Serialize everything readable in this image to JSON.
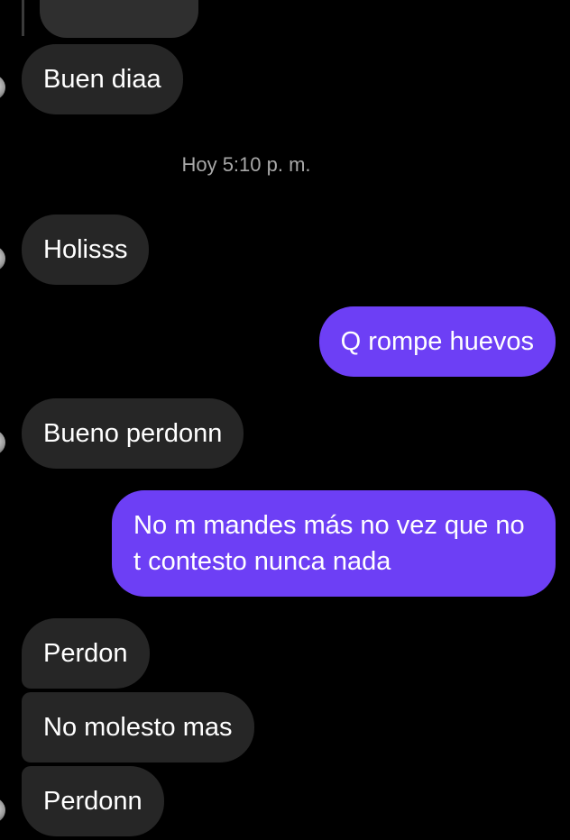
{
  "messages": [
    {
      "id": "m1",
      "direction": "in",
      "text": "Buen diaa"
    },
    {
      "id": "m2",
      "direction": "in",
      "text": "Holisss"
    },
    {
      "id": "m3",
      "direction": "out",
      "text": "Q rompe huevos"
    },
    {
      "id": "m4",
      "direction": "in",
      "text": "Bueno perdonn"
    },
    {
      "id": "m5",
      "direction": "out",
      "text": "No m mandes más no vez que no t contesto nunca nada"
    },
    {
      "id": "m6",
      "direction": "in",
      "text": "Perdon"
    },
    {
      "id": "m7",
      "direction": "in",
      "text": "No molesto mas"
    },
    {
      "id": "m8",
      "direction": "in",
      "text": "Perdonn"
    }
  ],
  "timestamp": "Hoy 5:10 p. m.",
  "colors": {
    "incoming_bubble": "#262626",
    "outgoing_bubble": "#6d3ff5",
    "background": "#000000",
    "timestamp_text": "#a8a8a8"
  }
}
